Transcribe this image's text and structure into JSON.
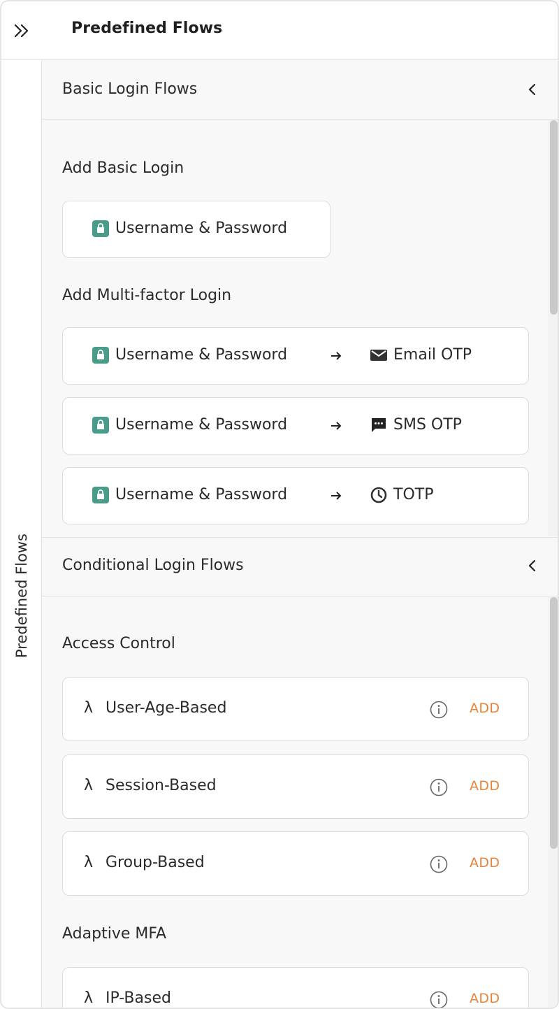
{
  "header": {
    "title": "Predefined Flows",
    "expand_icon": "double-chevron-right-icon"
  },
  "rail": {
    "label": "Predefined Flows"
  },
  "basic_section": {
    "title": "Basic Login Flows",
    "add_basic_label": "Add Basic Login",
    "basic_card": {
      "label": "Username & Password",
      "icon": "lock-icon"
    },
    "add_mfa_label": "Add Multi-factor Login",
    "mfa_cards": [
      {
        "first": "Username & Password",
        "second": "Email OTP",
        "second_icon": "email-icon"
      },
      {
        "first": "Username & Password",
        "second": "SMS OTP",
        "second_icon": "sms-icon"
      },
      {
        "first": "Username & Password",
        "second": "TOTP",
        "second_icon": "clock-icon"
      }
    ]
  },
  "conditional_section": {
    "title": "Conditional Login Flows",
    "access_control_label": "Access Control",
    "access_items": [
      {
        "symbol": "λ",
        "name": "User-Age-Based",
        "action": "ADD"
      },
      {
        "symbol": "λ",
        "name": "Session-Based",
        "action": "ADD"
      },
      {
        "symbol": "λ",
        "name": "Group-Based",
        "action": "ADD"
      }
    ],
    "adaptive_label": "Adaptive MFA",
    "adaptive_items": [
      {
        "symbol": "λ",
        "name": "IP-Based",
        "action": "ADD"
      }
    ]
  },
  "colors": {
    "lock_teal": "#4a9c8a",
    "add_orange": "#e8833a",
    "border": "#dcdcdc",
    "panel_bg": "#f8f8f8"
  }
}
